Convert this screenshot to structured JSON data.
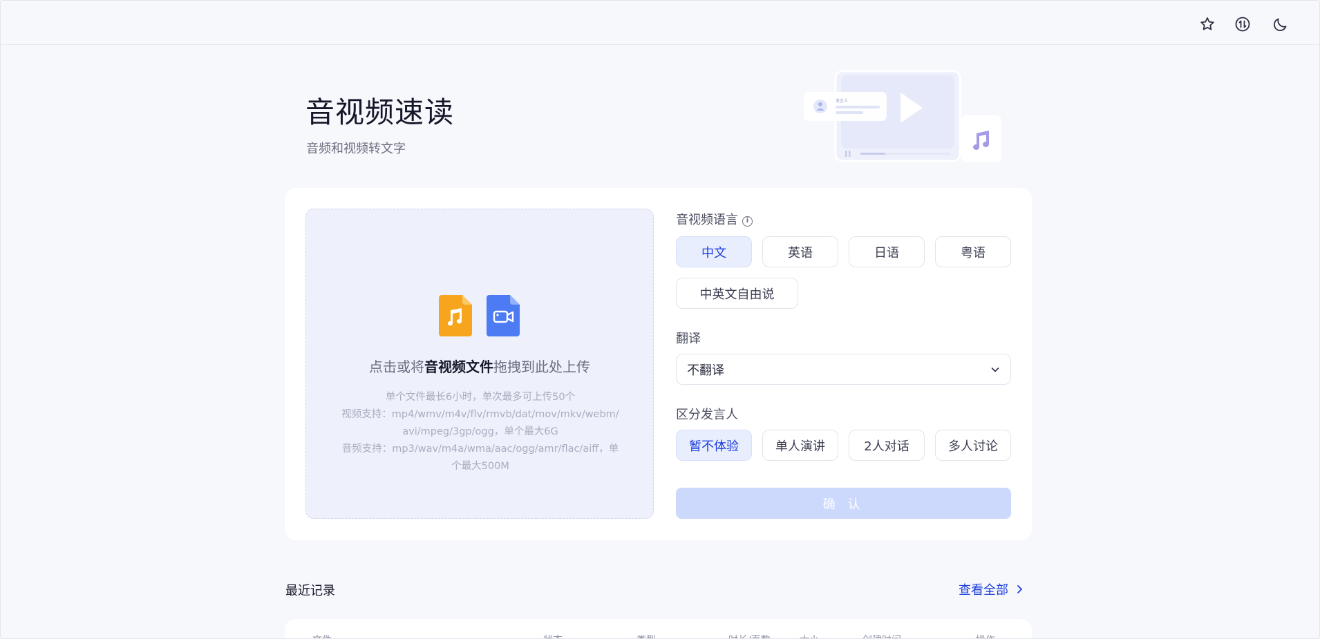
{
  "header": {
    "icons": [
      "star-icon",
      "switch-icon",
      "moon-icon"
    ]
  },
  "hero": {
    "title": "音视频速读",
    "subtitle": "音频和视频转文字",
    "illustration_label": "发言人"
  },
  "upload": {
    "main_prefix": "点击或将",
    "main_bold": "音视频文件",
    "main_suffix": "拖拽到此处上传",
    "hint_1": "单个文件最长6小时，单次最多可上传50个",
    "hint_2": "视频支持：mp4/wmv/m4v/flv/rmvb/dat/mov/mkv/webm/avi/mpeg/3gp/ogg，单个最大6G",
    "hint_3": "音频支持：mp3/wav/m4a/wma/aac/ogg/amr/flac/aiff，单个最大500M"
  },
  "language": {
    "label": "音视频语言",
    "info_glyph": "i",
    "options": [
      "中文",
      "英语",
      "日语",
      "粤语",
      "中英文自由说"
    ],
    "selected": "中文"
  },
  "translate": {
    "label": "翻译",
    "value": "不翻译"
  },
  "speaker": {
    "label": "区分发言人",
    "options": [
      "暂不体验",
      "单人演讲",
      "2人对话",
      "多人讨论"
    ],
    "selected": "暂不体验"
  },
  "confirm_label": "确 认",
  "recent": {
    "title": "最近记录",
    "view_all": "查看全部",
    "columns": [
      "文件",
      "状态",
      "类型",
      "时长/页数",
      "大小",
      "创建时间",
      "操作"
    ]
  },
  "colors": {
    "accent": "#1b3ddb",
    "confirm_disabled": "#cdd8fd",
    "upload_bg": "#eef1fc",
    "audio_file": "#f7a51c",
    "video_file": "#4c7bf4"
  }
}
